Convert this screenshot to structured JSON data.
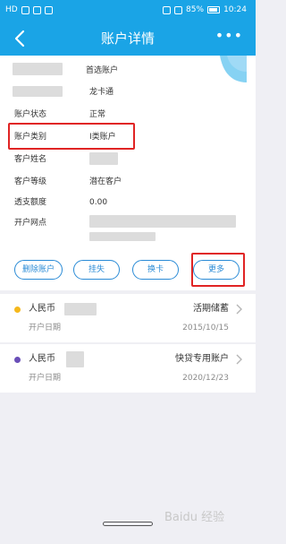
{
  "status": {
    "left": "HD",
    "battery": "85%",
    "time": "10:24"
  },
  "header": {
    "title": "账户详情",
    "more": "•••"
  },
  "account": {
    "primary_tag": "首选账户",
    "card_name": "龙卡通",
    "fields": [
      {
        "label": "账户状态",
        "value": "正常"
      },
      {
        "label": "账户类别",
        "value": "I类账户"
      },
      {
        "label": "客户姓名",
        "value": ""
      },
      {
        "label": "客户等级",
        "value": "潜在客户"
      },
      {
        "label": "透支额度",
        "value": "0.00"
      },
      {
        "label": "开户网点",
        "value": ""
      }
    ]
  },
  "actions": {
    "delete": "删除账户",
    "freeze": "挂失",
    "replace": "换卡",
    "more": "更多"
  },
  "sub_accounts": [
    {
      "currency": "人民币",
      "type": "活期储蓄",
      "date_label": "开户日期",
      "date": "2015/10/15",
      "dot_color": "#f5b81c"
    },
    {
      "currency": "人民币",
      "type": "快贷专用账户",
      "date_label": "开户日期",
      "date": "2020/12/23",
      "dot_color": "#6a4fb8"
    }
  ],
  "colors": {
    "brand": "#1aa4e6",
    "button": "#2a8bd6",
    "highlight": "#e02424"
  },
  "watermark": "Baidu 经验"
}
